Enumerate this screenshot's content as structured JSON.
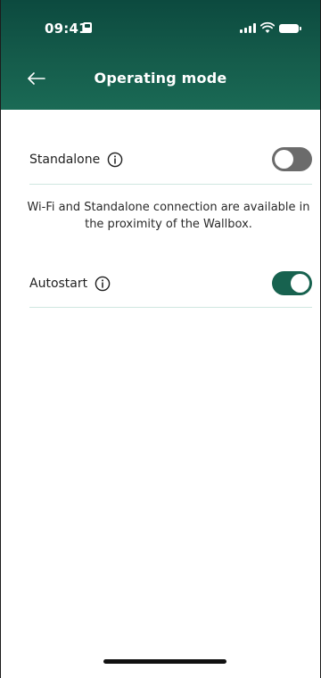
{
  "status_bar": {
    "time": "09:41",
    "icons": [
      "sim-card-icon",
      "signal-icon",
      "wifi-icon",
      "battery-icon"
    ]
  },
  "nav": {
    "back_icon": "arrow-left-icon",
    "title": "Operating mode"
  },
  "settings": {
    "standalone": {
      "label": "Standalone",
      "info_icon": "info-icon",
      "enabled": false
    },
    "helper_text": "Wi-Fi and Standalone connection are available in the proximity of the Wallbox.",
    "autostart": {
      "label": "Autostart",
      "info_icon": "info-icon",
      "enabled": true
    }
  },
  "colors": {
    "header_bg": "#0c4a3f",
    "accent": "#17624f",
    "toggle_off": "#6b6b6b",
    "divider": "#cfe7e0"
  }
}
